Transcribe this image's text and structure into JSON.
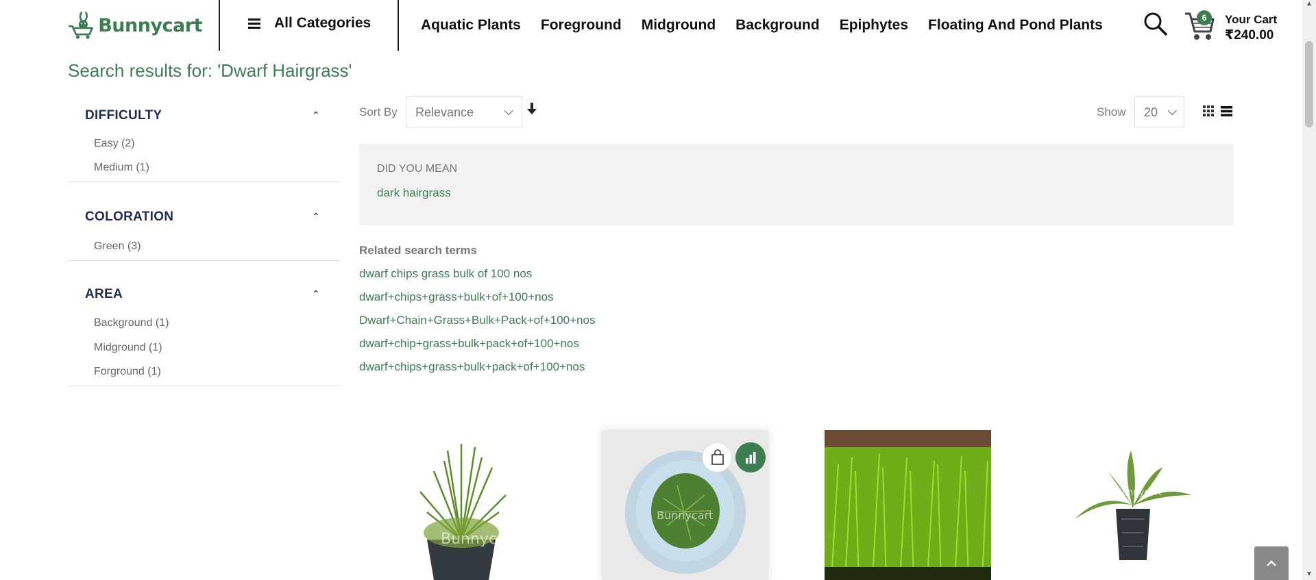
{
  "brand": {
    "name": "Bunnycart",
    "color": "#3d7d52"
  },
  "header": {
    "all_categories": "All Categories",
    "nav": [
      "Aquatic Plants",
      "Foreground",
      "Midground",
      "Background",
      "Epiphytes",
      "Floating And Pond Plants"
    ],
    "cart": {
      "count": "6",
      "label": "Your Cart",
      "amount": "₹240.00"
    },
    "icons": [
      "hamburger-icon",
      "search-icon",
      "cart-icon"
    ]
  },
  "search": {
    "title": "Search results for: 'Dwarf Hairgrass'"
  },
  "filters": [
    {
      "title": "DIFFICULTY",
      "items": [
        "Easy (2)",
        "Medium (1)"
      ]
    },
    {
      "title": "COLORATION",
      "items": [
        "Green (3)"
      ]
    },
    {
      "title": "AREA",
      "items": [
        "Background (1)",
        "Midground (1)",
        "Forground (1)"
      ]
    }
  ],
  "toolbar": {
    "sort_label": "Sort By",
    "sort_value": "Relevance",
    "show_label": "Show",
    "show_value": "20"
  },
  "did_you_mean": {
    "heading": "DID YOU MEAN",
    "suggestion": "dark hairgrass"
  },
  "related": {
    "heading": "Related search terms",
    "terms": [
      "dwarf chips grass bulk of 100 nos",
      "dwarf+chips+grass+bulk+of+100+nos",
      "Dwarf+Chain+Grass+Bulk+Pack+of+100+nos",
      "dwarf+chip+grass+bulk+pack+of+100+nos",
      "dwarf+chips+grass+bulk+pack+of+100+nos"
    ]
  },
  "products": [
    {
      "image": "potted-hairgrass",
      "watermark": "Bunnycart"
    },
    {
      "image": "hairgrass-in-cup",
      "watermark": "Bunnycart"
    },
    {
      "image": "hairgrass-carpet"
    },
    {
      "image": "potted-plant",
      "watermark": "Bunnycart"
    }
  ]
}
